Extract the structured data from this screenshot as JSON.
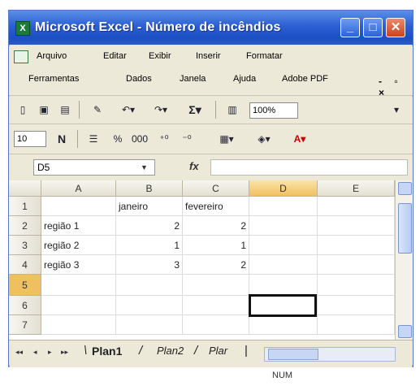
{
  "window": {
    "title": "Microsoft Excel - Número de incêndios",
    "app_icon": "X",
    "min_label": "_",
    "max_label": "□",
    "close_label": "✕"
  },
  "menu": {
    "row1": [
      "Arquivo",
      "Editar",
      "Exibir",
      "Inserir",
      "Formatar"
    ],
    "row2": [
      "Ferramentas",
      "Dados",
      "Janela",
      "Ajuda",
      "Adobe PDF"
    ],
    "right_controls": "- ▫ ×"
  },
  "toolbar": {
    "zoom": "100%",
    "sum_symbol": "Σ",
    "font_size": "10",
    "bold": "N"
  },
  "formula_bar": {
    "name_box": "D5",
    "fx": "fx",
    "formula": ""
  },
  "sheet": {
    "columns": [
      "A",
      "B",
      "C",
      "D",
      "E"
    ],
    "active_column": "D",
    "rows": [
      {
        "num": "1",
        "cells": [
          "",
          "janeiro",
          "fevereiro",
          "",
          ""
        ]
      },
      {
        "num": "2",
        "cells": [
          "região 1",
          "2",
          "2",
          "",
          ""
        ]
      },
      {
        "num": "3",
        "cells": [
          "região 2",
          "1",
          "1",
          "",
          ""
        ]
      },
      {
        "num": "4",
        "cells": [
          "região 3",
          "3",
          "2",
          "",
          ""
        ]
      },
      {
        "num": "5",
        "cells": [
          "",
          "",
          "",
          "",
          ""
        ]
      },
      {
        "num": "6",
        "cells": [
          "",
          "",
          "",
          "",
          ""
        ]
      },
      {
        "num": "7",
        "cells": [
          "",
          "",
          "",
          "",
          ""
        ]
      }
    ],
    "selected_cell": "D5"
  },
  "tabs": {
    "nav": [
      "◂◂",
      "◂",
      "▸",
      "▸▸"
    ],
    "sheets": [
      "Plan1",
      "Plan2",
      "Plar"
    ],
    "active": "Plan1"
  },
  "status": {
    "num": "NUM"
  },
  "colors": {
    "title_bar": "#2c5fd2",
    "selected_header": "#f0c060",
    "chrome": "#ece9d8"
  }
}
